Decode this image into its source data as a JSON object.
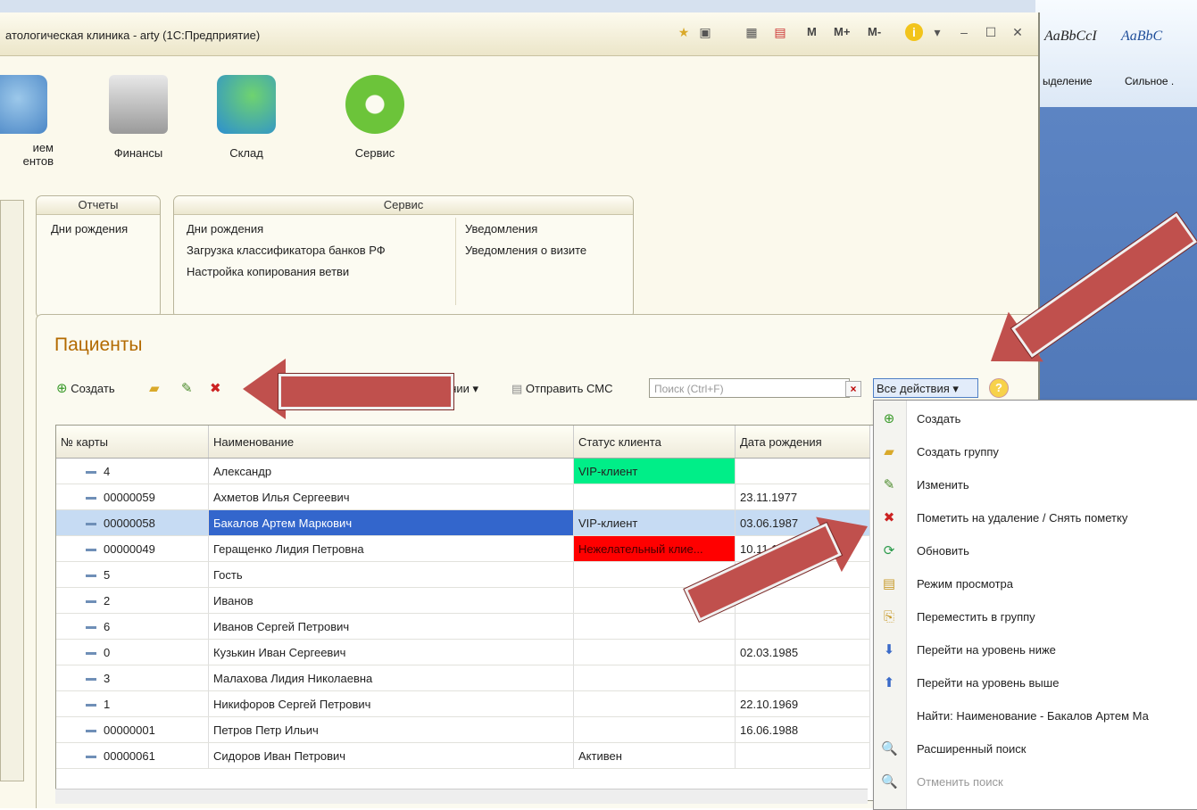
{
  "window": {
    "title": "атологическая клиника - arty  (1С:Предприятие)"
  },
  "title_icons": {
    "m": "M",
    "mplus": "M+",
    "mminus": "M-",
    "minimize": "–",
    "maximize": "☐",
    "close": "✕"
  },
  "word": {
    "style1": "AaBbCcI",
    "style2": "AaBbC",
    "label1": "ыделение",
    "label2": "Сильное ."
  },
  "sections": [
    {
      "label": "ием\nентов",
      "icon": "doctor-icon"
    },
    {
      "label": "Финансы",
      "icon": "cash-register-icon"
    },
    {
      "label": "Склад",
      "icon": "medicine-icon"
    },
    {
      "label": "Сервис",
      "icon": "gear-icon"
    }
  ],
  "groups": {
    "reports": {
      "title": "Отчеты",
      "links": [
        "Дни рождения"
      ]
    },
    "service": {
      "title": "Сервис",
      "col1": [
        "Дни рождения",
        "Загрузка классификатора банков РФ",
        "Настройка копирования ветви"
      ],
      "col2": [
        "Уведомления",
        "Уведомления о визите"
      ]
    }
  },
  "patients": {
    "title": "Пациенты",
    "toolbar": {
      "create": "Создать",
      "partial": "ании ▾",
      "sms": "Отправить СМС",
      "search_placeholder": "Поиск (Ctrl+F)",
      "all_actions": "Все действия ▾"
    },
    "columns": [
      "№ карты",
      "Наименование",
      "Статус клиента",
      "Дата рождения"
    ],
    "rows": [
      {
        "card": "4",
        "name": "Александр",
        "status": "VIP-клиент",
        "dob": "",
        "status_color": "#00ee88"
      },
      {
        "card": "00000059",
        "name": "Ахметов Илья Сергеевич",
        "status": "",
        "dob": "23.11.1977"
      },
      {
        "card": "00000058",
        "name": "Бакалов Артем Маркович",
        "status": "VIP-клиент",
        "dob": "03.06.1987",
        "selected": true
      },
      {
        "card": "00000049",
        "name": "Геращенко Лидия Петровна",
        "status": "Нежелательный клие...",
        "dob": "10.11.19",
        "status_color": "#ff0000"
      },
      {
        "card": "5",
        "name": "Гость",
        "status": "",
        "dob": ""
      },
      {
        "card": "2",
        "name": "Иванов",
        "status": "",
        "dob": ""
      },
      {
        "card": "6",
        "name": "Иванов Сергей Петрович",
        "status": "",
        "dob": ""
      },
      {
        "card": "0",
        "name": "Кузькин Иван Сергеевич",
        "status": "",
        "dob": "02.03.1985"
      },
      {
        "card": "3",
        "name": "Малахова Лидия Николаевна",
        "status": "",
        "dob": ""
      },
      {
        "card": "1",
        "name": "Никифоров Сергей Петрович",
        "status": "",
        "dob": "22.10.1969"
      },
      {
        "card": "00000001",
        "name": "Петров Петр Ильич",
        "status": "",
        "dob": "16.06.1988"
      },
      {
        "card": "00000061",
        "name": "Сидоров Иван Петрович",
        "status": "Активен",
        "dob": ""
      }
    ]
  },
  "menu": [
    {
      "label": "Создать",
      "icon": "plus-circle-icon",
      "glyph": "⊕",
      "color": "#3a9a2a"
    },
    {
      "label": "Создать группу",
      "icon": "folder-add-icon",
      "glyph": "▰",
      "color": "#d9a92a"
    },
    {
      "label": "Изменить",
      "icon": "pencil-icon",
      "glyph": "✎",
      "color": "#4a8a2a"
    },
    {
      "label": "Пометить на удаление / Снять пометку",
      "icon": "delete-mark-icon",
      "glyph": "✖",
      "color": "#cc2222"
    },
    {
      "label": "Обновить",
      "icon": "refresh-icon",
      "glyph": "⟳",
      "color": "#2a9a4a"
    },
    {
      "label": "Режим просмотра",
      "icon": "view-mode-icon",
      "glyph": "▤",
      "color": "#c89a2a"
    },
    {
      "label": "Переместить в группу",
      "icon": "move-to-group-icon",
      "glyph": "⎘",
      "color": "#c89a2a"
    },
    {
      "label": "Перейти на уровень ниже",
      "icon": "level-down-icon",
      "glyph": "⬇",
      "color": "#3a6ac8"
    },
    {
      "label": "Перейти на уровень выше",
      "icon": "level-up-icon",
      "glyph": "⬆",
      "color": "#3a6ac8"
    },
    {
      "label": "Найти: Наименование - Бакалов Артем Ма",
      "icon": "",
      "glyph": "",
      "color": "#222"
    },
    {
      "label": "Расширенный поиск",
      "icon": "search-icon",
      "glyph": "🔍",
      "color": "#555"
    },
    {
      "label": "Отменить поиск",
      "icon": "cancel-search-icon",
      "glyph": "🔍",
      "color": "#aaa",
      "disabled": true
    }
  ]
}
